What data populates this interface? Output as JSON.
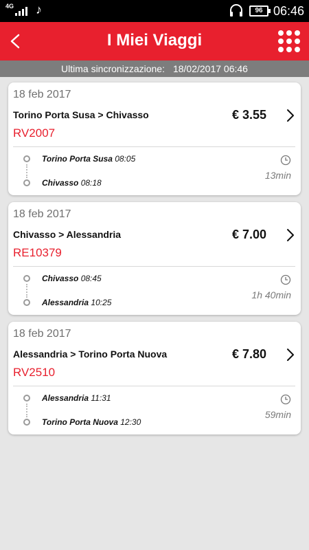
{
  "status_bar": {
    "network": "4G",
    "clock": "06:46",
    "battery": "96"
  },
  "header": {
    "title": "I Miei Viaggi"
  },
  "sync": {
    "label": "Ultima sincronizzazione:",
    "value": "18/02/2017 06:46"
  },
  "trips": [
    {
      "date": "18 feb 2017",
      "route": "Torino Porta Susa > Chivasso",
      "price": "€ 3.55",
      "train_code": "RV2007",
      "departure_station": "Torino Porta Susa",
      "departure_time": "08:05",
      "arrival_station": "Chivasso",
      "arrival_time": "08:18",
      "duration": "13min"
    },
    {
      "date": "18 feb 2017",
      "route": "Chivasso > Alessandria",
      "price": "€ 7.00",
      "train_code": "RE10379",
      "departure_station": "Chivasso",
      "departure_time": "08:45",
      "arrival_station": "Alessandria",
      "arrival_time": "10:25",
      "duration": "1h 40min"
    },
    {
      "date": "18 feb 2017",
      "route": "Alessandria > Torino Porta Nuova",
      "price": "€ 7.80",
      "train_code": "RV2510",
      "departure_station": "Alessandria",
      "departure_time": "11:31",
      "arrival_station": "Torino Porta Nuova",
      "arrival_time": "12:30",
      "duration": "59min"
    }
  ],
  "icons": {
    "back": "chevron-left-icon",
    "menu": "grid-menu-icon",
    "open_trip": "chevron-right-icon",
    "duration": "clock-icon",
    "music": "music-note-icon",
    "headset": "headset-icon"
  },
  "colors": {
    "accent": "#e8202e",
    "sync_bar": "#7d7d7d",
    "background": "#e6e6e6"
  }
}
